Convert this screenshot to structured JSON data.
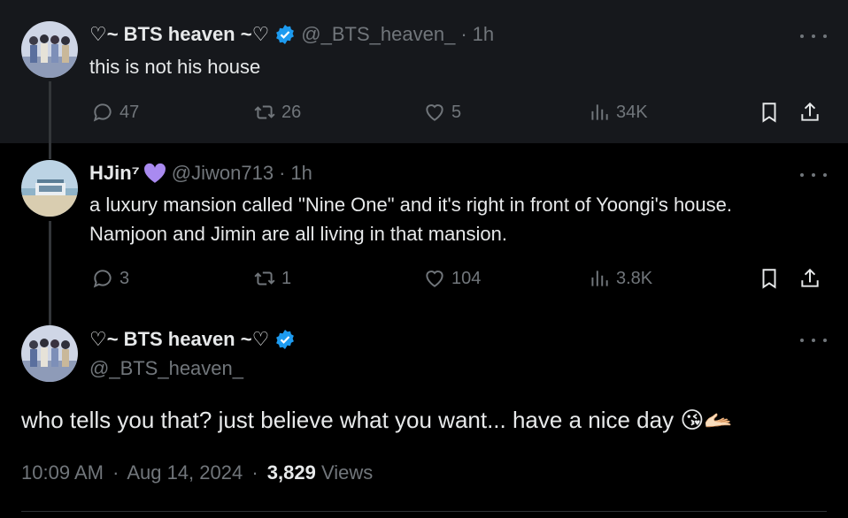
{
  "tweet1": {
    "author_name": "♡~ BTS heaven ~♡",
    "handle": "@_BTS_heaven_",
    "separator": "·",
    "time": "1h",
    "text": "this is not his house",
    "replies": "47",
    "retweets": "26",
    "likes": "5",
    "views": "34K"
  },
  "tweet2": {
    "author_name": "HJin⁷",
    "handle": "@Jiwon713",
    "separator": "·",
    "time": "1h",
    "text_line1": "a luxury mansion called \"Nine One\" and it's right in front of Yoongi's house.",
    "text_line2": "Namjoon and Jimin are all living in that mansion.",
    "replies": "3",
    "retweets": "1",
    "likes": "104",
    "views": "3.8K"
  },
  "main_tweet": {
    "author_name": "♡~ BTS heaven ~♡",
    "handle": "@_BTS_heaven_",
    "text": "who tells you that? just believe what you want... have a nice day 😘🫴🏻",
    "time": "10:09 AM",
    "separator": "·",
    "date": "Aug 14, 2024",
    "views_count": "3,829",
    "views_label": "Views"
  },
  "colors": {
    "background": "#000000",
    "highlight_background": "#16181c",
    "verified_blue": "#1d9bf0",
    "purple_heart": "#a98af0",
    "muted_text": "#71767b"
  },
  "icons": [
    "reply-icon",
    "retweet-icon",
    "like-icon",
    "views-icon",
    "bookmark-icon",
    "share-icon",
    "verified-icon",
    "more-icon"
  ]
}
